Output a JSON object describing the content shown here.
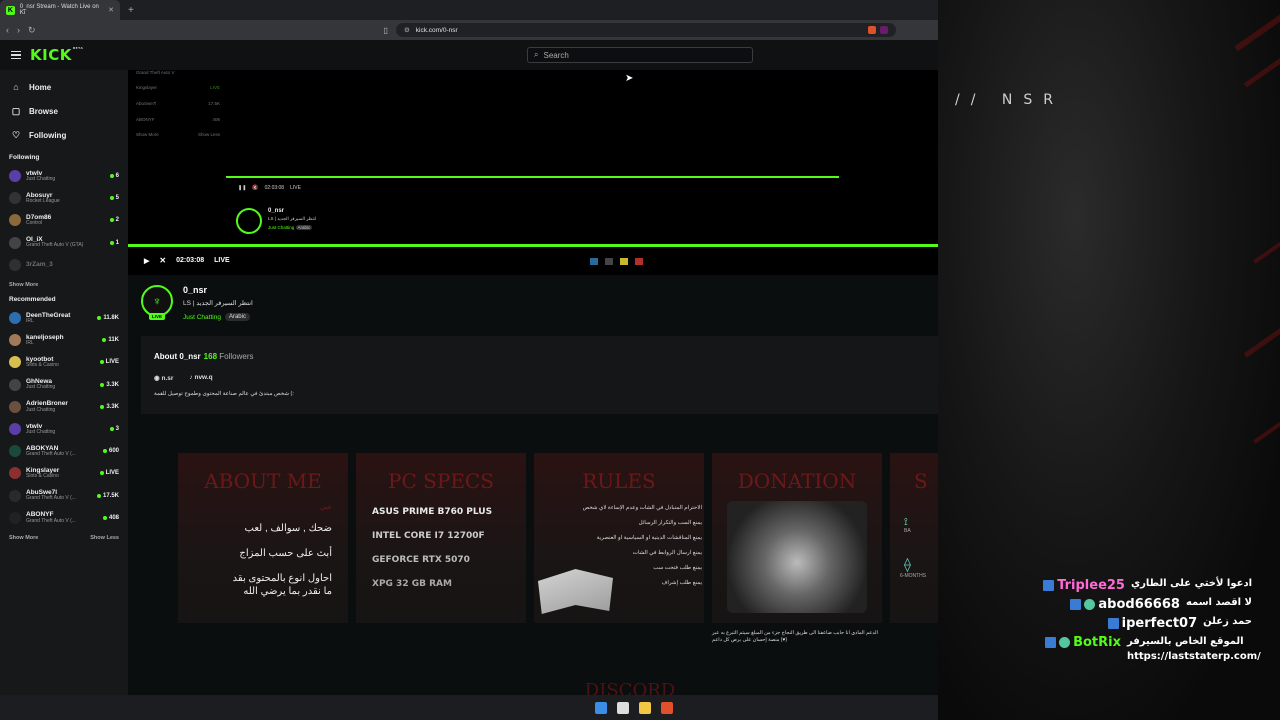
{
  "browser": {
    "tab_title": "0_nsr Stream - Watch Live on Ki",
    "tab_close": "✕",
    "new_tab": "+",
    "url": "kick.com/0-nsr"
  },
  "header": {
    "logo": "KICK",
    "logo_sup": "BETA",
    "search_placeholder": "Search"
  },
  "sidebar": {
    "nav": [
      {
        "label": "Home",
        "icon": "⌂"
      },
      {
        "label": "Browse",
        "icon": "▢"
      },
      {
        "label": "Following",
        "icon": "♡"
      }
    ],
    "following_title": "Following",
    "following": [
      {
        "name": "vtwlv",
        "category": "Just Chatting",
        "count": "6",
        "color": "#5b3fa6"
      },
      {
        "name": "Abosuyr",
        "category": "Rocket League",
        "count": "5",
        "color": "#333"
      },
      {
        "name": "D7om86",
        "category": "Control",
        "count": "2",
        "color": "#8a6a3a"
      },
      {
        "name": "OI_iX",
        "category": "Grand Theft Auto V (GTA)",
        "count": "1",
        "color": "#444"
      },
      {
        "name": "3rZam_3",
        "category": "",
        "count": "",
        "color": "#555"
      }
    ],
    "show_more": "Show More",
    "recommended_title": "Recommended",
    "recommended": [
      {
        "name": "DeenTheGreat",
        "category": "IRL",
        "count": "11.8K",
        "color": "#2c6fb0"
      },
      {
        "name": "kaneljoseph",
        "category": "IRL",
        "count": "11K",
        "color": "#a07a5a"
      },
      {
        "name": "kyootbot",
        "category": "Slots & Casino",
        "count": "LIVE",
        "color": "#d8c050"
      },
      {
        "name": "GhNewa",
        "category": "Just Chatting",
        "count": "3.3K",
        "color": "#444"
      },
      {
        "name": "AdrienBroner",
        "category": "Just Chatting",
        "count": "3.3K",
        "color": "#6a5040"
      },
      {
        "name": "vtwlv",
        "category": "Just Chatting",
        "count": "3",
        "color": "#5b3fa6"
      },
      {
        "name": "ABOKYAN",
        "category": "Grand Theft Auto V (...",
        "count": "600",
        "color": "#1a4a3a"
      },
      {
        "name": "Kingslayer",
        "category": "Slots & Casino",
        "count": "LIVE",
        "color": "#8a3030"
      },
      {
        "name": "AbuSwe7l",
        "category": "Grand Theft Auto V (...",
        "count": "17.5K",
        "color": "#2a2a2a"
      },
      {
        "name": "ABONYF",
        "category": "Grand Theft Auto V (...",
        "count": "408",
        "color": "#222"
      }
    ],
    "show_more2": "Show More",
    "show_less": "Show Less"
  },
  "player": {
    "time": "02:03:08",
    "live": "LIVE",
    "play_icon": "▶",
    "mute_icon": "🔇",
    "nested_rows": [
      {
        "name": "Grand Theft Auto V",
        "count": ""
      },
      {
        "name": "Kingslayer",
        "count": "LIVE"
      },
      {
        "name": "AbuSwe7l",
        "count": "17.5K"
      },
      {
        "name": "ABONYF",
        "count": "406"
      }
    ],
    "nested_time": "02:03:08",
    "nested_live": "LIVE",
    "nested_name": "0_nsr",
    "nested_title": "LS | انتظر السيرفر الجديد",
    "nested_cat": "Just Chatting",
    "nested_tag": "Arabic",
    "nested_show_more": "Show More",
    "nested_show_less": "Show Less"
  },
  "channel": {
    "name": "0_nsr",
    "title": "LS | انتظر السيرفر الجديد",
    "category": "Just Chatting",
    "tag": "Arabic",
    "live_badge": "LIVE",
    "about_title": "About 0_nsr",
    "followers_count": "168",
    "followers_label": "Followers",
    "socials": [
      {
        "icon": "discord-icon",
        "glyph": "◉",
        "label": "n.sr"
      },
      {
        "icon": "tiktok-icon",
        "glyph": "♪",
        "label": "nvw.q"
      }
    ],
    "bio": "شخص مبتدئ في عالم صناعة المحتوى وطموح توصيل للقمة (:"
  },
  "panels": {
    "about_title": "ABOUT ME",
    "about_sub": "عني",
    "about_lines": [
      "ضحك , سوالف , لعب",
      "أبث على حسب المزاج",
      "احاول انوع  بالمحتوى بقد",
      "ما نقدر بما يرضي الله"
    ],
    "specs_title": "PC SPECS",
    "specs": [
      "ASUS PRIME B760 PLUS",
      "INTEL CORE I7 12700F",
      "GEFORCE RTX 5070",
      "XPG 32 GB RAM"
    ],
    "rules_title": "RULES",
    "rules": [
      "الاحترام المتبادل في الشات وعدم الإساءة لاي شخص",
      "يمنع السب والتكرار الرسائل",
      "يمنع المناقشات الدينية او السياسية او العنصرية",
      "يمنع ارسال الروابط في الشات",
      "يمنع طلب فتحت سب",
      "يمنع طلب إشراف"
    ],
    "donation_title": "DONATION",
    "donation_note": "الدعم المادي انا حابب ضاعفنا الى طريق النجاح جزء من المبلغ سيتم التبرع به عبر منصة إحسان على برص كل داعم (♥)",
    "next_title": "S",
    "next_labels": [
      "BA",
      "6-MONTHS"
    ],
    "discord_title": "DISCORD"
  },
  "overlay": {
    "brand": "// NSR",
    "chat": [
      {
        "user": "Triplee25",
        "color": "#ff6ad5",
        "text": "ادعوا لأختي على الطاري",
        "badges": 1
      },
      {
        "user": "abod66668",
        "color": "#ffffff",
        "text": "لا اقصد اسمه",
        "badges": 2
      },
      {
        "user": "iperfect07",
        "color": "#ffffff",
        "text": "حمد زعلن",
        "badges": 1
      },
      {
        "user": "BotRix",
        "color": "#53fc18",
        "text": "الموقع الخاص بالسيرفر https://laststaterp.com/",
        "badges": 2
      }
    ]
  }
}
